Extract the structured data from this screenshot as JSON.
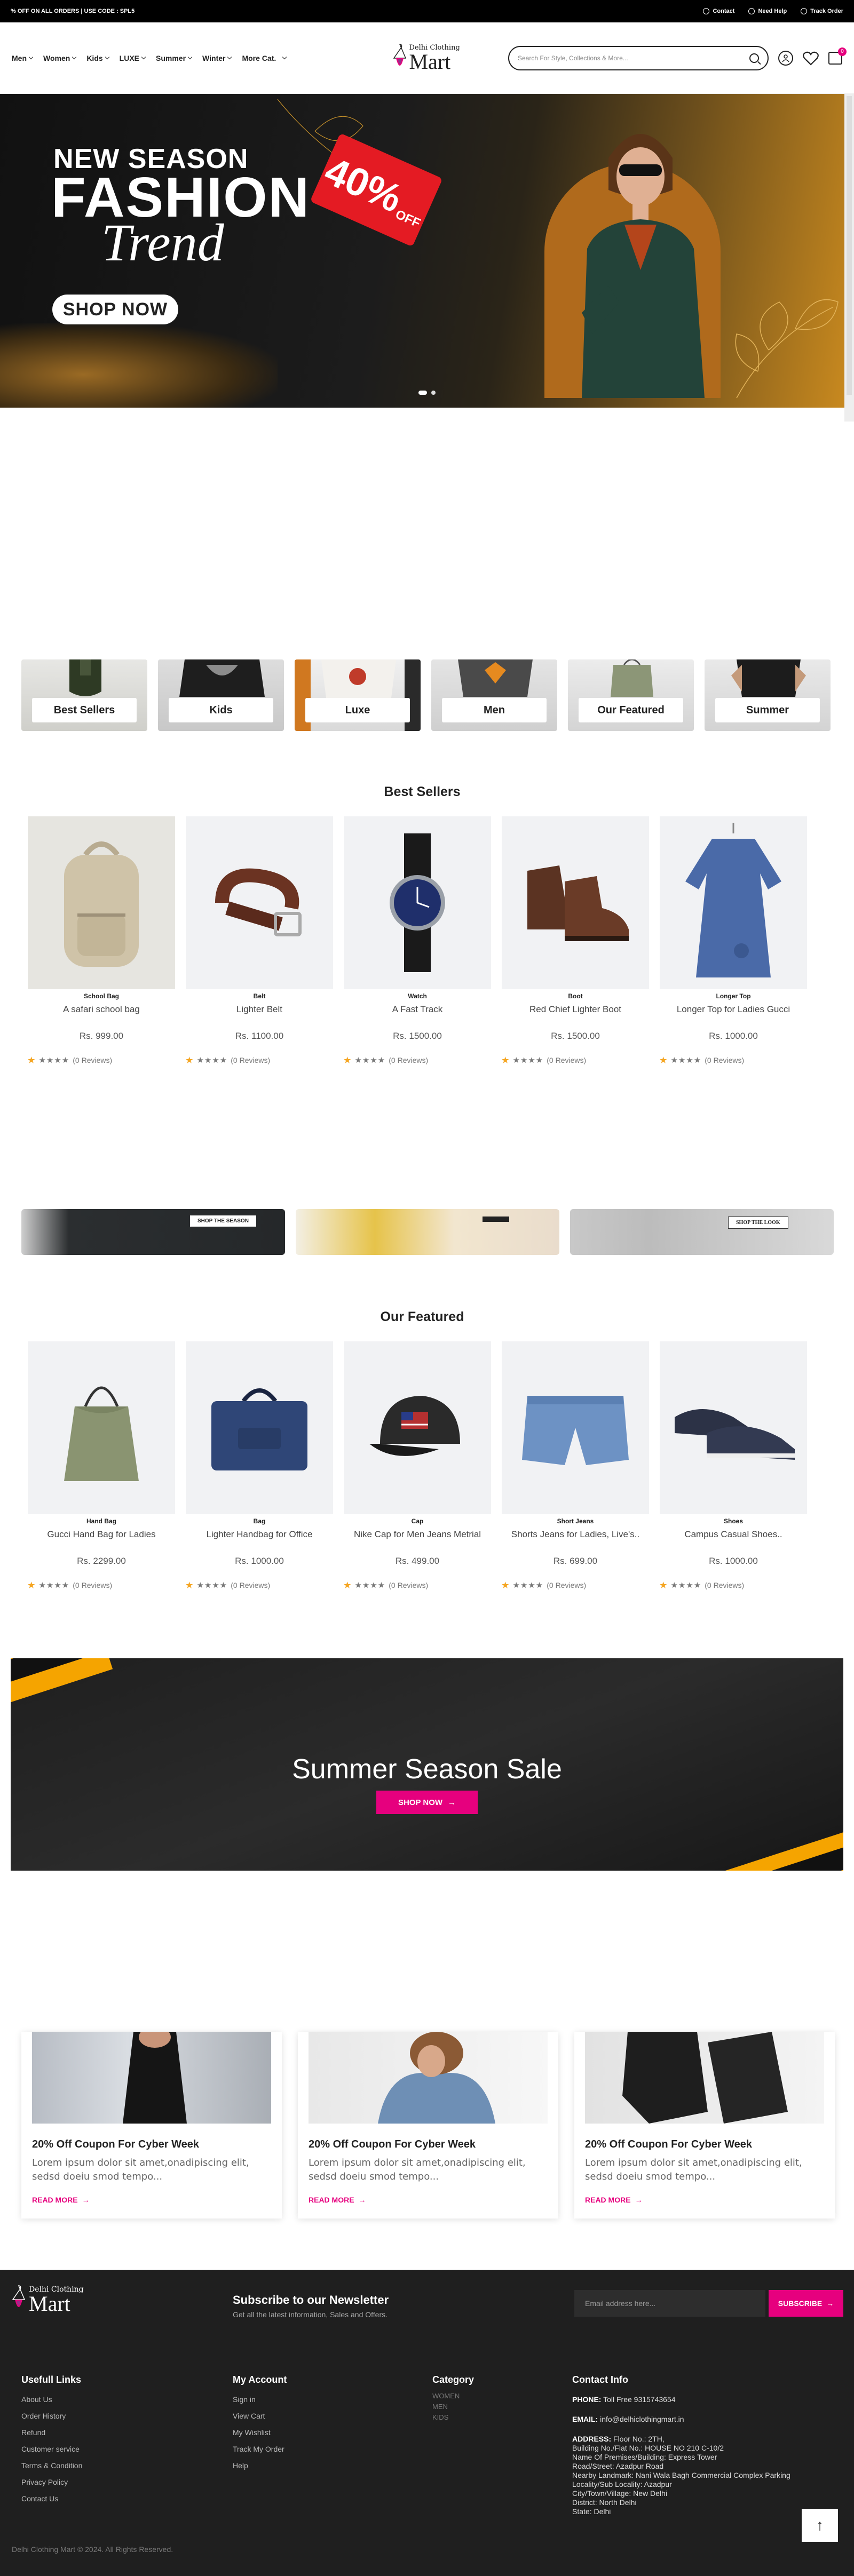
{
  "topbar": {
    "promo": "% OFF ON ALL ORDERS | USE CODE : SPL5",
    "contact": "Contact",
    "help": "Need Help",
    "track": "Track Order"
  },
  "nav": {
    "items": [
      "Men",
      "Women",
      "Kids",
      "LUXE",
      "Summer",
      "Winter",
      "More Cat."
    ]
  },
  "logo": {
    "line1": "Delhi Clothing",
    "line2": "Mart"
  },
  "search": {
    "placeholder": "Search For Style, Collections & More..."
  },
  "cart": {
    "count": "0"
  },
  "hero": {
    "line1": "NEW SEASON",
    "line2": "FASHION",
    "line3": "Trend",
    "discount": "40%",
    "off": "OFF",
    "cta": "SHOP NOW"
  },
  "categories": [
    "Best Sellers",
    "Kids",
    "Luxe",
    "Men",
    "Our Featured",
    "Summer"
  ],
  "best_sellers": {
    "title": "Best Sellers",
    "products": [
      {
        "category": "School Bag",
        "name": "A safari school bag",
        "price": "Rs. 999.00",
        "reviews": "(0 Reviews)",
        "icon": "backpack-icon"
      },
      {
        "category": "Belt",
        "name": "Lighter Belt",
        "price": "Rs. 1100.00",
        "reviews": "(0 Reviews)",
        "icon": "belt-icon"
      },
      {
        "category": "Watch",
        "name": "A Fast Track",
        "price": "Rs. 1500.00",
        "reviews": "(0 Reviews)",
        "icon": "watch-icon"
      },
      {
        "category": "Boot",
        "name": "Red Chief Lighter Boot",
        "price": "Rs. 1500.00",
        "reviews": "(0 Reviews)",
        "icon": "boot-icon"
      },
      {
        "category": "Longer Top",
        "name": "Longer Top for Ladies Gucci",
        "price": "Rs. 1000.00",
        "reviews": "(0 Reviews)",
        "icon": "dress-icon"
      }
    ]
  },
  "promo_banners": {
    "btn1": "SHOP THE SEASON",
    "btn3": "SHOP THE LOOK"
  },
  "featured": {
    "title": "Our Featured",
    "products": [
      {
        "category": "Hand Bag",
        "name": "Gucci Hand Bag for Ladies",
        "price": "Rs. 2299.00",
        "reviews": "(0 Reviews)",
        "icon": "handbag-icon"
      },
      {
        "category": "Bag",
        "name": "Lighter Handbag for Office",
        "price": "Rs. 1000.00",
        "reviews": "(0 Reviews)",
        "icon": "office-bag-icon"
      },
      {
        "category": "Cap",
        "name": "Nike Cap for Men Jeans Metrial",
        "price": "Rs. 499.00",
        "reviews": "(0 Reviews)",
        "icon": "cap-icon"
      },
      {
        "category": "Short Jeans",
        "name": "Shorts Jeans for Ladies, Live's..",
        "price": "Rs. 699.00",
        "reviews": "(0 Reviews)",
        "icon": "shorts-icon"
      },
      {
        "category": "Shoes",
        "name": "Campus Casual Shoes..",
        "price": "Rs. 1000.00",
        "reviews": "(0 Reviews)",
        "icon": "shoes-icon"
      }
    ]
  },
  "sale": {
    "title": "Summer Season Sale",
    "cta": "SHOP NOW"
  },
  "blog": {
    "posts": [
      {
        "title": "20% Off Coupon For Cyber Week",
        "excerpt": "Lorem ipsum dolor sit amet,onadipiscing elit, sedsd doeiu smod tempo...",
        "cta": "READ MORE"
      },
      {
        "title": "20% Off Coupon For Cyber Week",
        "excerpt": "Lorem ipsum dolor sit amet,onadipiscing elit, sedsd doeiu smod tempo...",
        "cta": "READ MORE"
      },
      {
        "title": "20% Off Coupon For Cyber Week",
        "excerpt": "Lorem ipsum dolor sit amet,onadipiscing elit, sedsd doeiu smod tempo...",
        "cta": "READ MORE"
      }
    ]
  },
  "newsletter": {
    "title": "Subscribe to our Newsletter",
    "subtitle": "Get all the latest information, Sales and Offers.",
    "placeholder": "Email address here...",
    "button": "SUBSCRIBE"
  },
  "footer": {
    "links_title": "Usefull Links",
    "links": [
      "About Us",
      "Order History",
      "Refund",
      "Customer service",
      "Terms & Condition",
      "Privacy Policy",
      "Contact Us"
    ],
    "account_title": "My Account",
    "account": [
      "Sign in",
      "View Cart",
      "My Wishlist",
      "Track My Order",
      "Help"
    ],
    "category_title": "Category",
    "category": [
      "WOMEN",
      "MEN",
      "KIDS"
    ],
    "contact_title": "Contact Info",
    "phone_label": "PHONE:",
    "phone": "Toll Free 9315743654",
    "email_label": "EMAIL:",
    "email": "info@delhiclothingmart.in",
    "address_label": "ADDRESS:",
    "address": [
      "Floor No.: 2TH,",
      "Building No./Flat No.: HOUSE NO 210 C-10/2",
      "Name Of Premises/Building: Express Tower",
      "Road/Street: Azadpur Road",
      "Nearby Landmark: Nani Wala Bagh Commercial Complex Parking",
      "Locality/Sub Locality: Azadpur",
      "City/Town/Village: New Delhi",
      "District: North Delhi",
      "State: Delhi"
    ],
    "copyright": "Delhi Clothing Mart © 2024. All Rights Reserved."
  },
  "colors": {
    "accent": "#e6007e",
    "sale_stripe": "#f5a400",
    "footer_bg": "#1f1f1f"
  }
}
